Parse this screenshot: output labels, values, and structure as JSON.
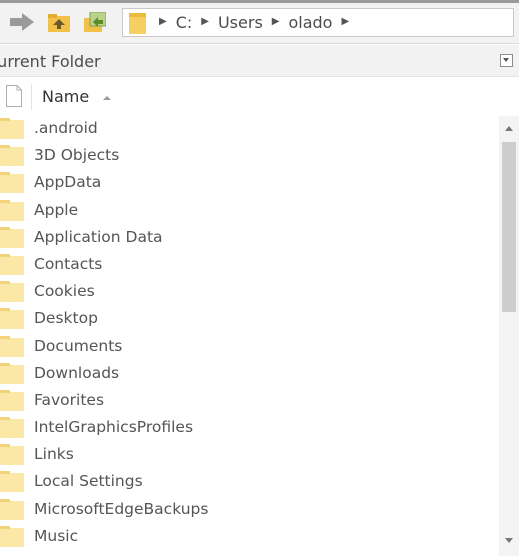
{
  "toolbar": {
    "icons": [
      "forward-arrow-icon",
      "up-folder-icon",
      "swap-folder-icon",
      "folder-icon"
    ],
    "breadcrumb": [
      "C:",
      "Users",
      "olado"
    ]
  },
  "panel": {
    "title": "Current Folder"
  },
  "columns": {
    "name": "Name"
  },
  "files": [
    ".android",
    "3D Objects",
    "AppData",
    "Apple",
    "Application Data",
    "Contacts",
    "Cookies",
    "Desktop",
    "Documents",
    "Downloads",
    "Favorites",
    "IntelGraphicsProfiles",
    "Links",
    "Local Settings",
    "MicrosoftEdgeBackups",
    "Music"
  ],
  "colors": {
    "folder": "#fbe7a6",
    "chrome": "#f2f2f2",
    "scroll_thumb": "#cdcdcd"
  }
}
